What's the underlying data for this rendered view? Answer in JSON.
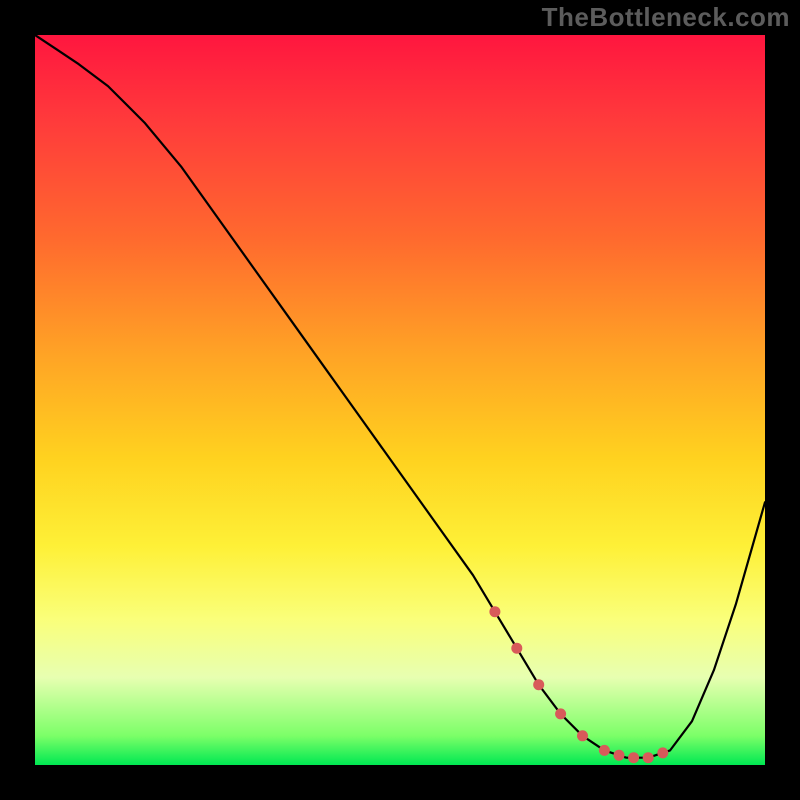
{
  "watermark": "TheBottleneck.com",
  "colors": {
    "background": "#000000",
    "curve": "#000000",
    "marker": "#d85a5a",
    "gradient_top": "#ff163f",
    "gradient_bottom": "#00e852"
  },
  "chart_data": {
    "type": "line",
    "title": "",
    "xlabel": "",
    "ylabel": "",
    "xlim": [
      0,
      100
    ],
    "ylim": [
      0,
      100
    ],
    "x": [
      0,
      3,
      6,
      10,
      15,
      20,
      25,
      30,
      35,
      40,
      45,
      50,
      55,
      60,
      63,
      66,
      69,
      72,
      75,
      78,
      81,
      84,
      87,
      90,
      93,
      96,
      100
    ],
    "values": [
      100,
      98,
      96,
      93,
      88,
      82,
      75,
      68,
      61,
      54,
      47,
      40,
      33,
      26,
      21,
      16,
      11,
      7,
      4,
      2,
      1,
      1,
      2,
      6,
      13,
      22,
      36
    ],
    "trough_markers_x": [
      63,
      66,
      69,
      72,
      75,
      78,
      80,
      82,
      84,
      86
    ]
  }
}
